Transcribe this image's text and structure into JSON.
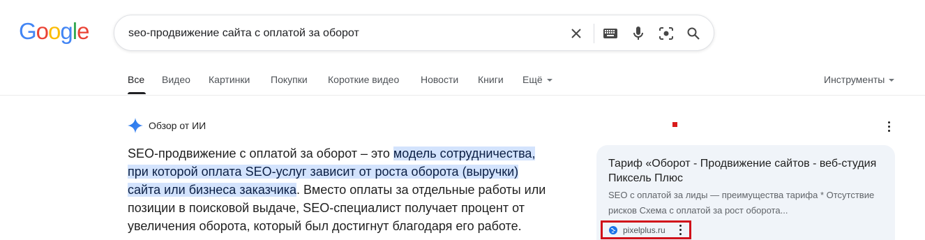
{
  "logo": {
    "letters": [
      "G",
      "o",
      "o",
      "g",
      "l",
      "e"
    ]
  },
  "search": {
    "query": "seo-продвижение сайта с оплатой за оборот",
    "icons": [
      "clear-icon",
      "keyboard-icon",
      "microphone-icon",
      "lens-icon",
      "search-icon"
    ]
  },
  "tabs": [
    "Все",
    "Видео",
    "Картинки",
    "Покупки",
    "Короткие видео",
    "Новости",
    "Книги",
    "Ещё"
  ],
  "tools_label": "Инструменты",
  "ai_overview": {
    "label": "Обзор от ИИ",
    "text_plain_1": "SEO-продвижение с оплатой за оборот – это ",
    "text_highlight_1": "модель сотрудничества,",
    "text_highlight_2": "при которой оплата SEO-услуг зависит от роста оборота (выручки)",
    "text_highlight_3": "сайта или бизнеса заказчика",
    "text_plain_2": ". Вместо оплаты за отдельные работы или позиции в поисковой выдаче, SEO-специалист получает процент от увеличения оборота, который был достигнут благодаря его работе."
  },
  "source_card": {
    "title": "Тариф «Оборот - Продвижение сайтов - веб-студия Пиксель Плюс",
    "snippet": "SEO с оплатой за лиды — преимущества тарифа * Отсутствие рисков Схема с оплатой за рост оборота...",
    "site": "pixelplus.ru"
  },
  "colors": {
    "highlight": "#d3e3fd",
    "card_bg": "#f0f4f9",
    "annotation_red": "#d0101a"
  }
}
